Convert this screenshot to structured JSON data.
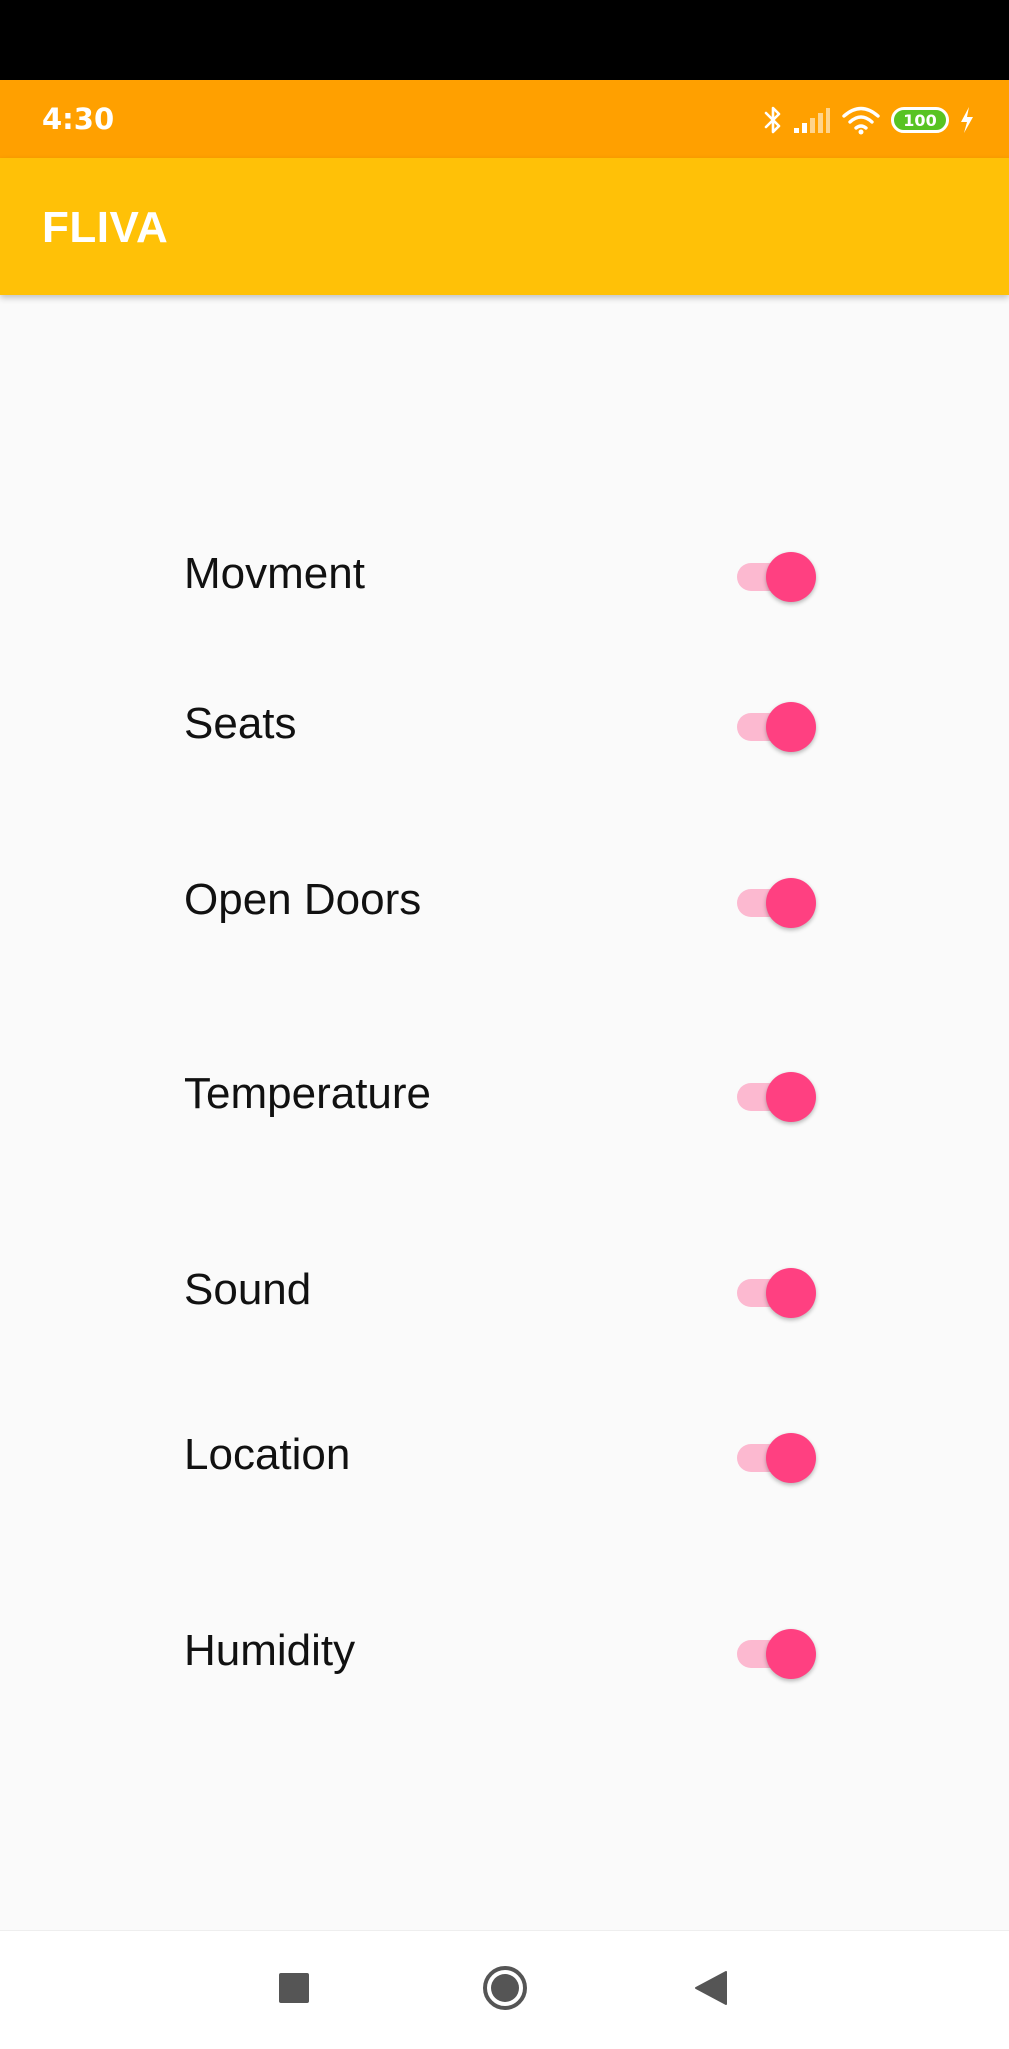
{
  "status_bar": {
    "time": "4:30",
    "battery_level": "100",
    "icons": [
      "bluetooth-icon",
      "cell-signal-icon",
      "wifi-icon",
      "battery-icon",
      "charging-icon"
    ]
  },
  "app_bar": {
    "title": "FLIVA"
  },
  "settings": [
    {
      "label": "Movment",
      "enabled": true
    },
    {
      "label": "Seats",
      "enabled": true
    },
    {
      "label": "Open Doors",
      "enabled": true
    },
    {
      "label": "Temperature",
      "enabled": true
    },
    {
      "label": "Sound",
      "enabled": true
    },
    {
      "label": "Location",
      "enabled": true
    },
    {
      "label": "Humidity",
      "enabled": true
    }
  ],
  "nav_bar": {
    "buttons": [
      "recents-square-icon",
      "home-circle-icon",
      "back-triangle-icon"
    ]
  },
  "colors": {
    "status_bar": "#ffa000",
    "app_bar": "#ffc107",
    "accent": "#ff4081",
    "background": "#fafafa",
    "nav_icon": "#555555"
  }
}
